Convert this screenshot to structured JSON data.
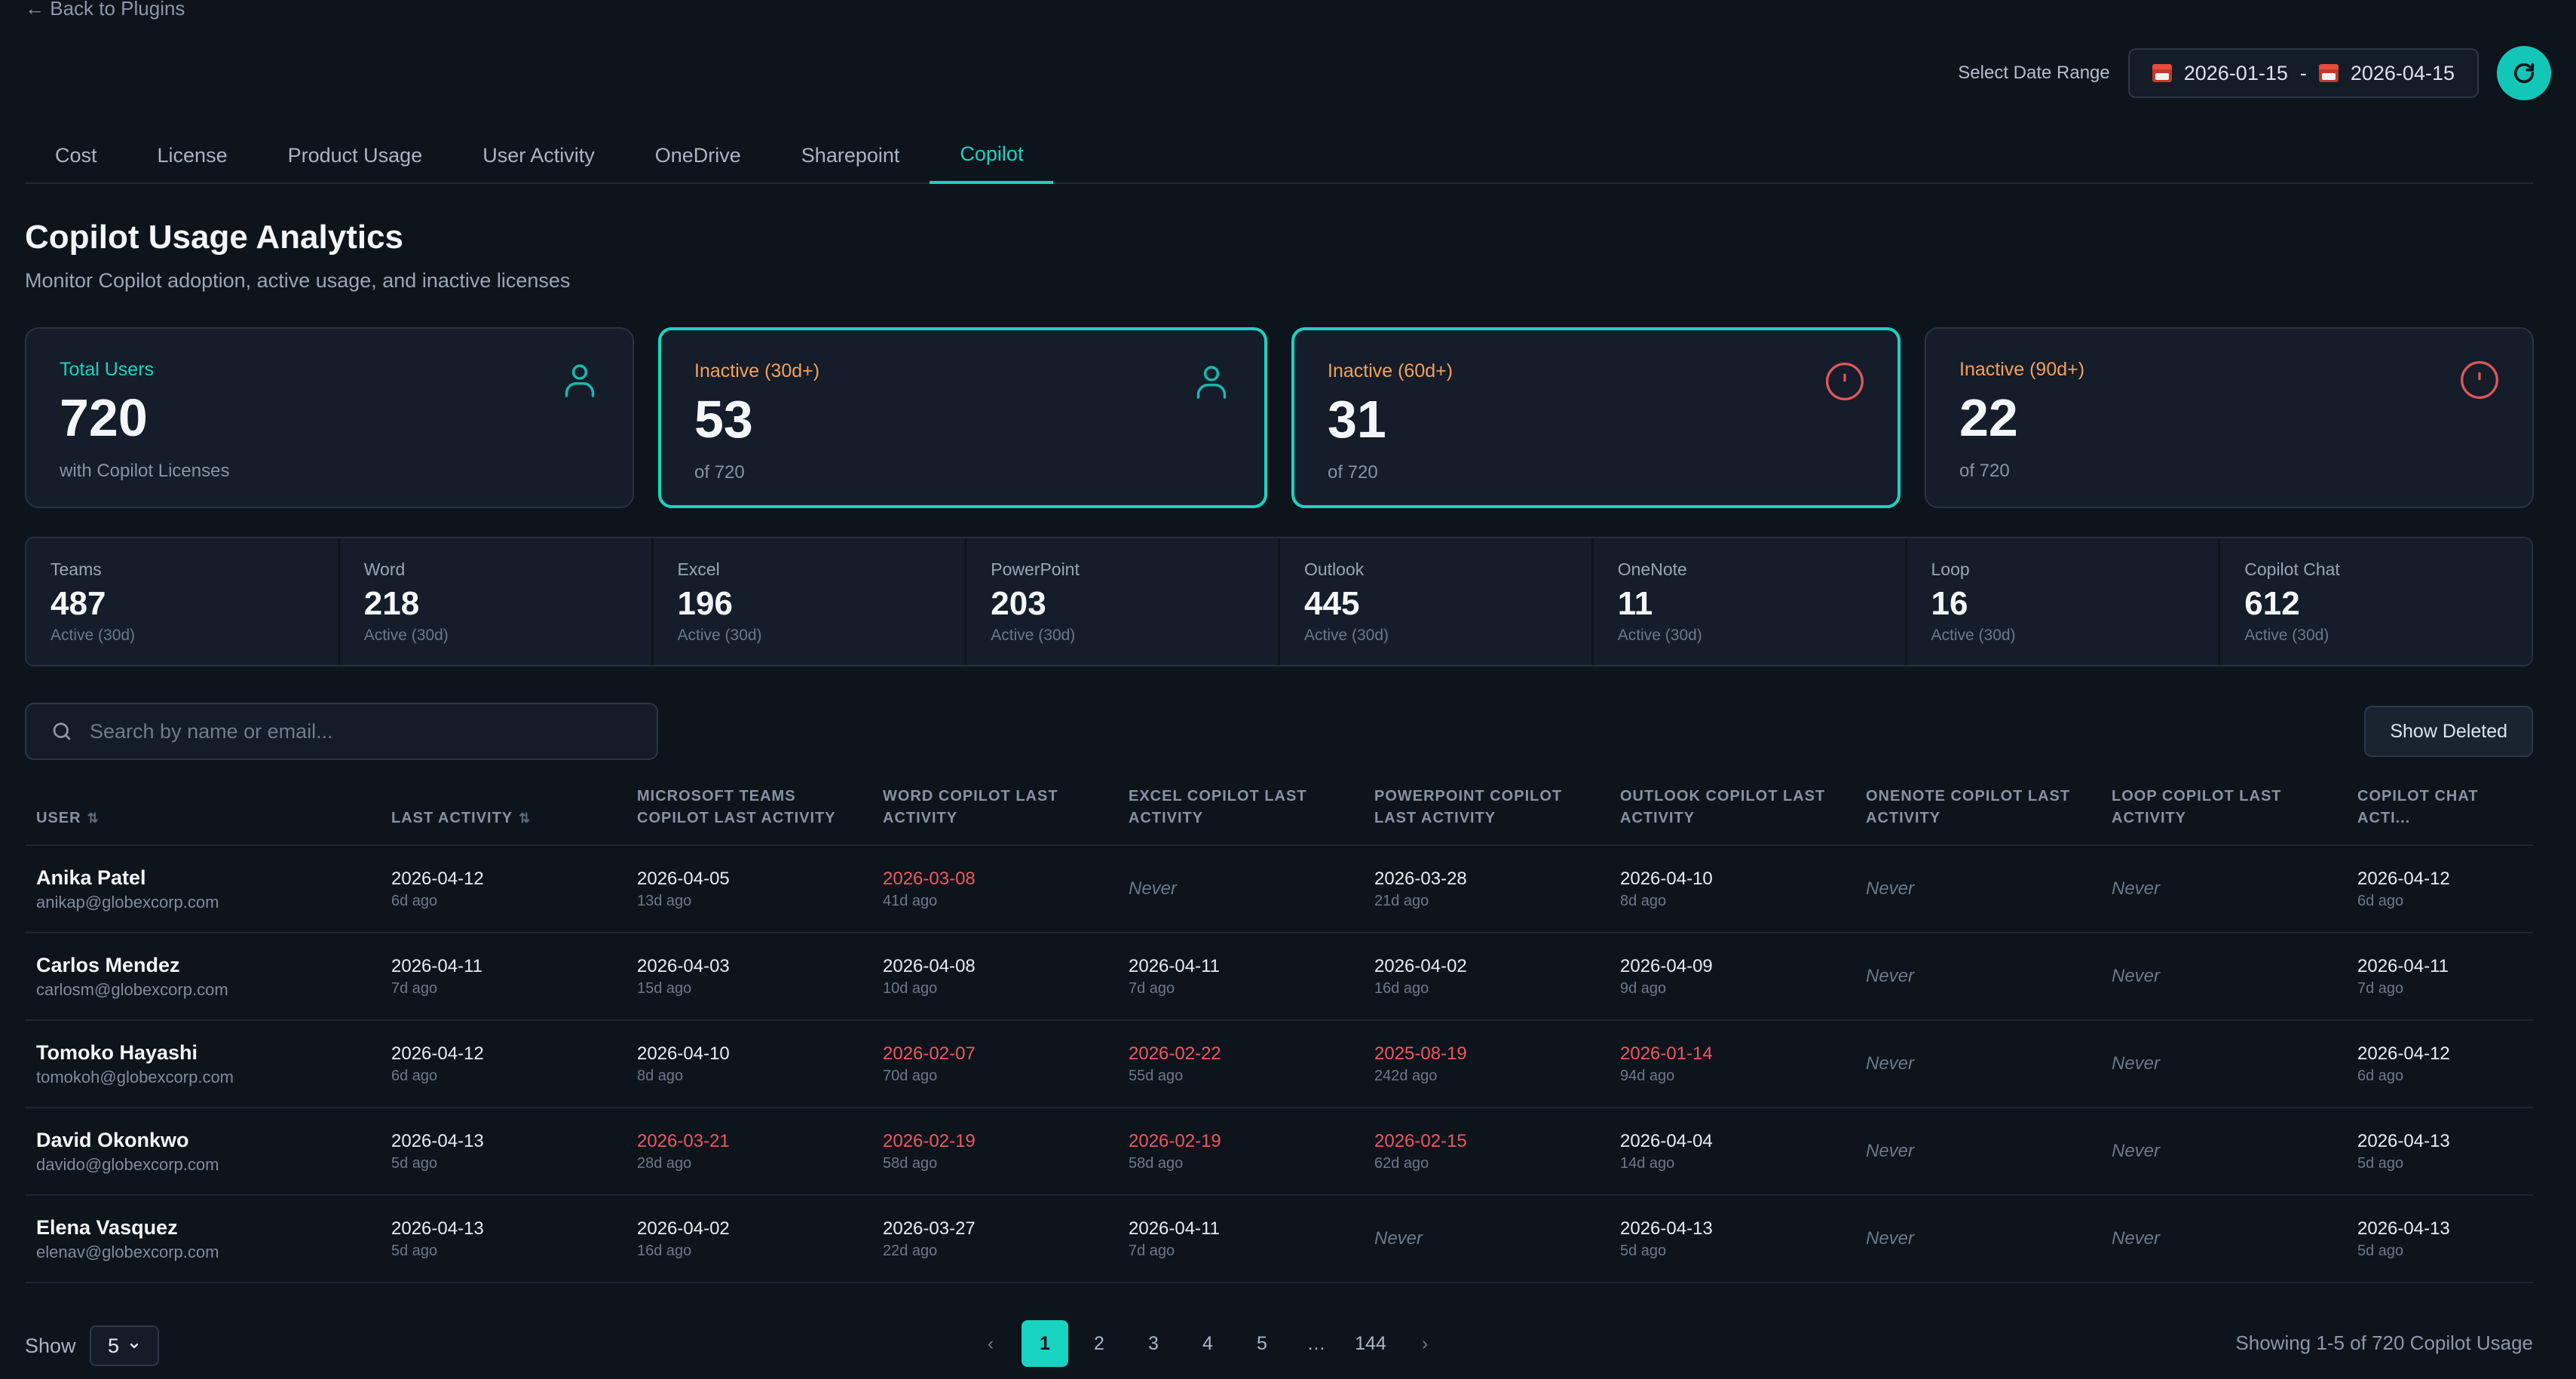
{
  "nav": {
    "back_label": "← Back to Plugins"
  },
  "date_range": {
    "label": "Select Date Range",
    "start": "2026-01-15",
    "separator": "-",
    "end": "2026-04-15"
  },
  "tabs": [
    {
      "label": "Cost"
    },
    {
      "label": "License"
    },
    {
      "label": "Product Usage"
    },
    {
      "label": "User Activity"
    },
    {
      "label": "OneDrive"
    },
    {
      "label": "Sharepoint"
    },
    {
      "label": "Copilot",
      "active": true
    }
  ],
  "header": {
    "title": "Copilot Usage Analytics",
    "subtitle": "Monitor Copilot adoption, active usage, and inactive licenses"
  },
  "colors": {
    "accent": "#19d3c1",
    "warning_label": "#f5a05a",
    "alert_red": "#f0575f",
    "total_label": "#19d3c1"
  },
  "cards": [
    {
      "label": "Total Users",
      "value": "720",
      "sub": "with Copilot Licenses",
      "icon": "user-icon"
    },
    {
      "label": "Inactive (30d+)",
      "value": "53",
      "sub": "of 720",
      "icon": "user-icon",
      "highlighted": true
    },
    {
      "label": "Inactive (60d+)",
      "value": "31",
      "sub": "of 720",
      "icon": "alert-circle-icon",
      "highlighted": true
    },
    {
      "label": "Inactive (90d+)",
      "value": "22",
      "sub": "of 720",
      "icon": "alert-circle-icon"
    }
  ],
  "apps": [
    {
      "name": "Teams",
      "value": "487",
      "sub": "Active (30d)"
    },
    {
      "name": "Word",
      "value": "218",
      "sub": "Active (30d)"
    },
    {
      "name": "Excel",
      "value": "196",
      "sub": "Active (30d)"
    },
    {
      "name": "PowerPoint",
      "value": "203",
      "sub": "Active (30d)"
    },
    {
      "name": "Outlook",
      "value": "445",
      "sub": "Active (30d)"
    },
    {
      "name": "OneNote",
      "value": "11",
      "sub": "Active (30d)"
    },
    {
      "name": "Loop",
      "value": "16",
      "sub": "Active (30d)"
    },
    {
      "name": "Copilot Chat",
      "value": "612",
      "sub": "Active (30d)"
    }
  ],
  "search": {
    "placeholder": "Search by name or email..."
  },
  "show_deleted_label": "Show Deleted",
  "table": {
    "columns": [
      {
        "label": "User",
        "sortable": true
      },
      {
        "label": "Last Activity",
        "sortable": true
      },
      {
        "label": "Microsoft Teams Copilot Last Activity"
      },
      {
        "label": "Word Copilot Last Activity"
      },
      {
        "label": "Excel Copilot Last Activity"
      },
      {
        "label": "PowerPoint Copilot Last Activity"
      },
      {
        "label": "Outlook Copilot Last Activity"
      },
      {
        "label": "OneNote Copilot Last Activity"
      },
      {
        "label": "Loop Copilot Last Activity"
      },
      {
        "label": "Copilot Chat Acti..."
      }
    ],
    "rows": [
      {
        "name": "Anika Patel",
        "email": "anikap@globexcorp.com",
        "cells": [
          {
            "date": "2026-04-12",
            "ago": "6d ago"
          },
          {
            "date": "2026-04-05",
            "ago": "13d ago"
          },
          {
            "date": "2026-03-08",
            "ago": "41d ago",
            "red": true
          },
          {
            "never": "Never"
          },
          {
            "date": "2026-03-28",
            "ago": "21d ago"
          },
          {
            "date": "2026-04-10",
            "ago": "8d ago"
          },
          {
            "never": "Never"
          },
          {
            "never": "Never"
          },
          {
            "date": "2026-04-12",
            "ago": "6d ago"
          }
        ]
      },
      {
        "name": "Carlos Mendez",
        "email": "carlosm@globexcorp.com",
        "cells": [
          {
            "date": "2026-04-11",
            "ago": "7d ago"
          },
          {
            "date": "2026-04-03",
            "ago": "15d ago"
          },
          {
            "date": "2026-04-08",
            "ago": "10d ago"
          },
          {
            "date": "2026-04-11",
            "ago": "7d ago"
          },
          {
            "date": "2026-04-02",
            "ago": "16d ago"
          },
          {
            "date": "2026-04-09",
            "ago": "9d ago"
          },
          {
            "never": "Never"
          },
          {
            "never": "Never"
          },
          {
            "date": "2026-04-11",
            "ago": "7d ago"
          }
        ]
      },
      {
        "name": "Tomoko Hayashi",
        "email": "tomokoh@globexcorp.com",
        "cells": [
          {
            "date": "2026-04-12",
            "ago": "6d ago"
          },
          {
            "date": "2026-04-10",
            "ago": "8d ago"
          },
          {
            "date": "2026-02-07",
            "ago": "70d ago",
            "red": true
          },
          {
            "date": "2026-02-22",
            "ago": "55d ago",
            "red": true
          },
          {
            "date": "2025-08-19",
            "ago": "242d ago",
            "red": true
          },
          {
            "date": "2026-01-14",
            "ago": "94d ago",
            "red": true
          },
          {
            "never": "Never"
          },
          {
            "never": "Never"
          },
          {
            "date": "2026-04-12",
            "ago": "6d ago"
          }
        ]
      },
      {
        "name": "David Okonkwo",
        "email": "davido@globexcorp.com",
        "cells": [
          {
            "date": "2026-04-13",
            "ago": "5d ago"
          },
          {
            "date": "2026-03-21",
            "ago": "28d ago",
            "red": true
          },
          {
            "date": "2026-02-19",
            "ago": "58d ago",
            "red": true
          },
          {
            "date": "2026-02-19",
            "ago": "58d ago",
            "red": true
          },
          {
            "date": "2026-02-15",
            "ago": "62d ago",
            "red": true
          },
          {
            "date": "2026-04-04",
            "ago": "14d ago"
          },
          {
            "never": "Never"
          },
          {
            "never": "Never"
          },
          {
            "date": "2026-04-13",
            "ago": "5d ago"
          }
        ]
      },
      {
        "name": "Elena Vasquez",
        "email": "elenav@globexcorp.com",
        "cells": [
          {
            "date": "2026-04-13",
            "ago": "5d ago"
          },
          {
            "date": "2026-04-02",
            "ago": "16d ago"
          },
          {
            "date": "2026-03-27",
            "ago": "22d ago"
          },
          {
            "date": "2026-04-11",
            "ago": "7d ago"
          },
          {
            "never": "Never"
          },
          {
            "date": "2026-04-13",
            "ago": "5d ago"
          },
          {
            "never": "Never"
          },
          {
            "never": "Never"
          },
          {
            "date": "2026-04-13",
            "ago": "5d ago"
          }
        ]
      }
    ]
  },
  "footer": {
    "show_label": "Show",
    "page_size": "5",
    "pages": [
      "1",
      "2",
      "3",
      "4",
      "5",
      "…",
      "144"
    ],
    "current_page": "1",
    "prev": "‹",
    "next": "›",
    "showing": "Showing 1-5 of 720 Copilot Usage"
  }
}
